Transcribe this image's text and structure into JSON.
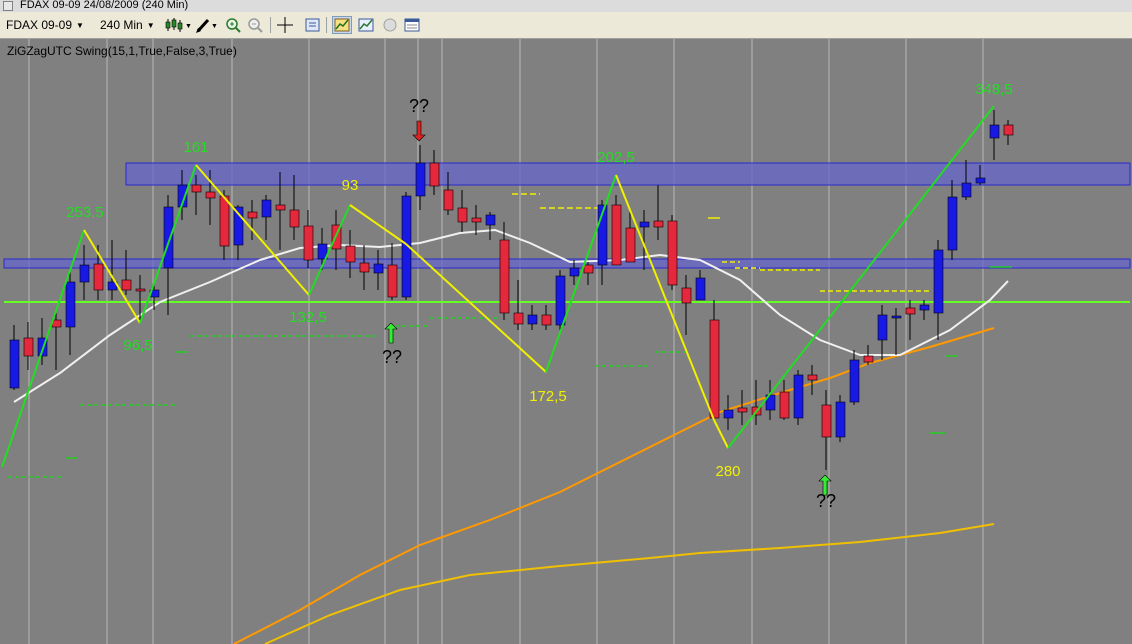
{
  "window": {
    "title": "FDAX 09-09   24/08/2009 (240 Min)"
  },
  "toolbar": {
    "instrument": "FDAX 09-09",
    "timeframe": "240 Min",
    "buttons": [
      "candlestick-chart-icon",
      "drawing-pencil-icon",
      "zoom-in-icon",
      "zoom-out-icon",
      "crosshair-icon",
      "properties-icon",
      "indicators-icon",
      "strategy-icon",
      "record-icon",
      "data-box-icon"
    ]
  },
  "indicator": {
    "label": "ZiGZagUTC Swing(15,1,True,False,3,True)"
  },
  "colors": {
    "background": "#808080",
    "gridline": "#b8b8b8",
    "bull_candle": "#1919e6",
    "bear_candle": "#e6283c",
    "zigzag_up": "#22dd22",
    "zigzag_down": "#f0f000",
    "zone_fill": "#6666cc",
    "support_line": "#66ff22",
    "ma_white": "#f0f0f0",
    "ma_orange": "#ff9900",
    "ma_yellow": "#f0c000"
  },
  "swing_labels": [
    {
      "text": "253,5",
      "color": "#22dd22"
    },
    {
      "text": "161",
      "color": "#22dd22"
    },
    {
      "text": "96,5",
      "color": "#22dd22"
    },
    {
      "text": "93",
      "color": "#f0f000"
    },
    {
      "text": "132,5",
      "color": "#22dd22"
    },
    {
      "text": "??",
      "color": "#000000"
    },
    {
      "text": "??",
      "color": "#000000"
    },
    {
      "text": "172,5",
      "color": "#f0f000"
    },
    {
      "text": "202,5",
      "color": "#22dd22"
    },
    {
      "text": "280",
      "color": "#f0f000"
    },
    {
      "text": "??",
      "color": "#000000"
    },
    {
      "text": "348,5",
      "color": "#22dd22"
    }
  ],
  "arrows": [
    {
      "direction": "down",
      "color": "#dd2222"
    },
    {
      "direction": "up",
      "color": "#33ee33"
    },
    {
      "direction": "up",
      "color": "#33ee33"
    }
  ]
}
